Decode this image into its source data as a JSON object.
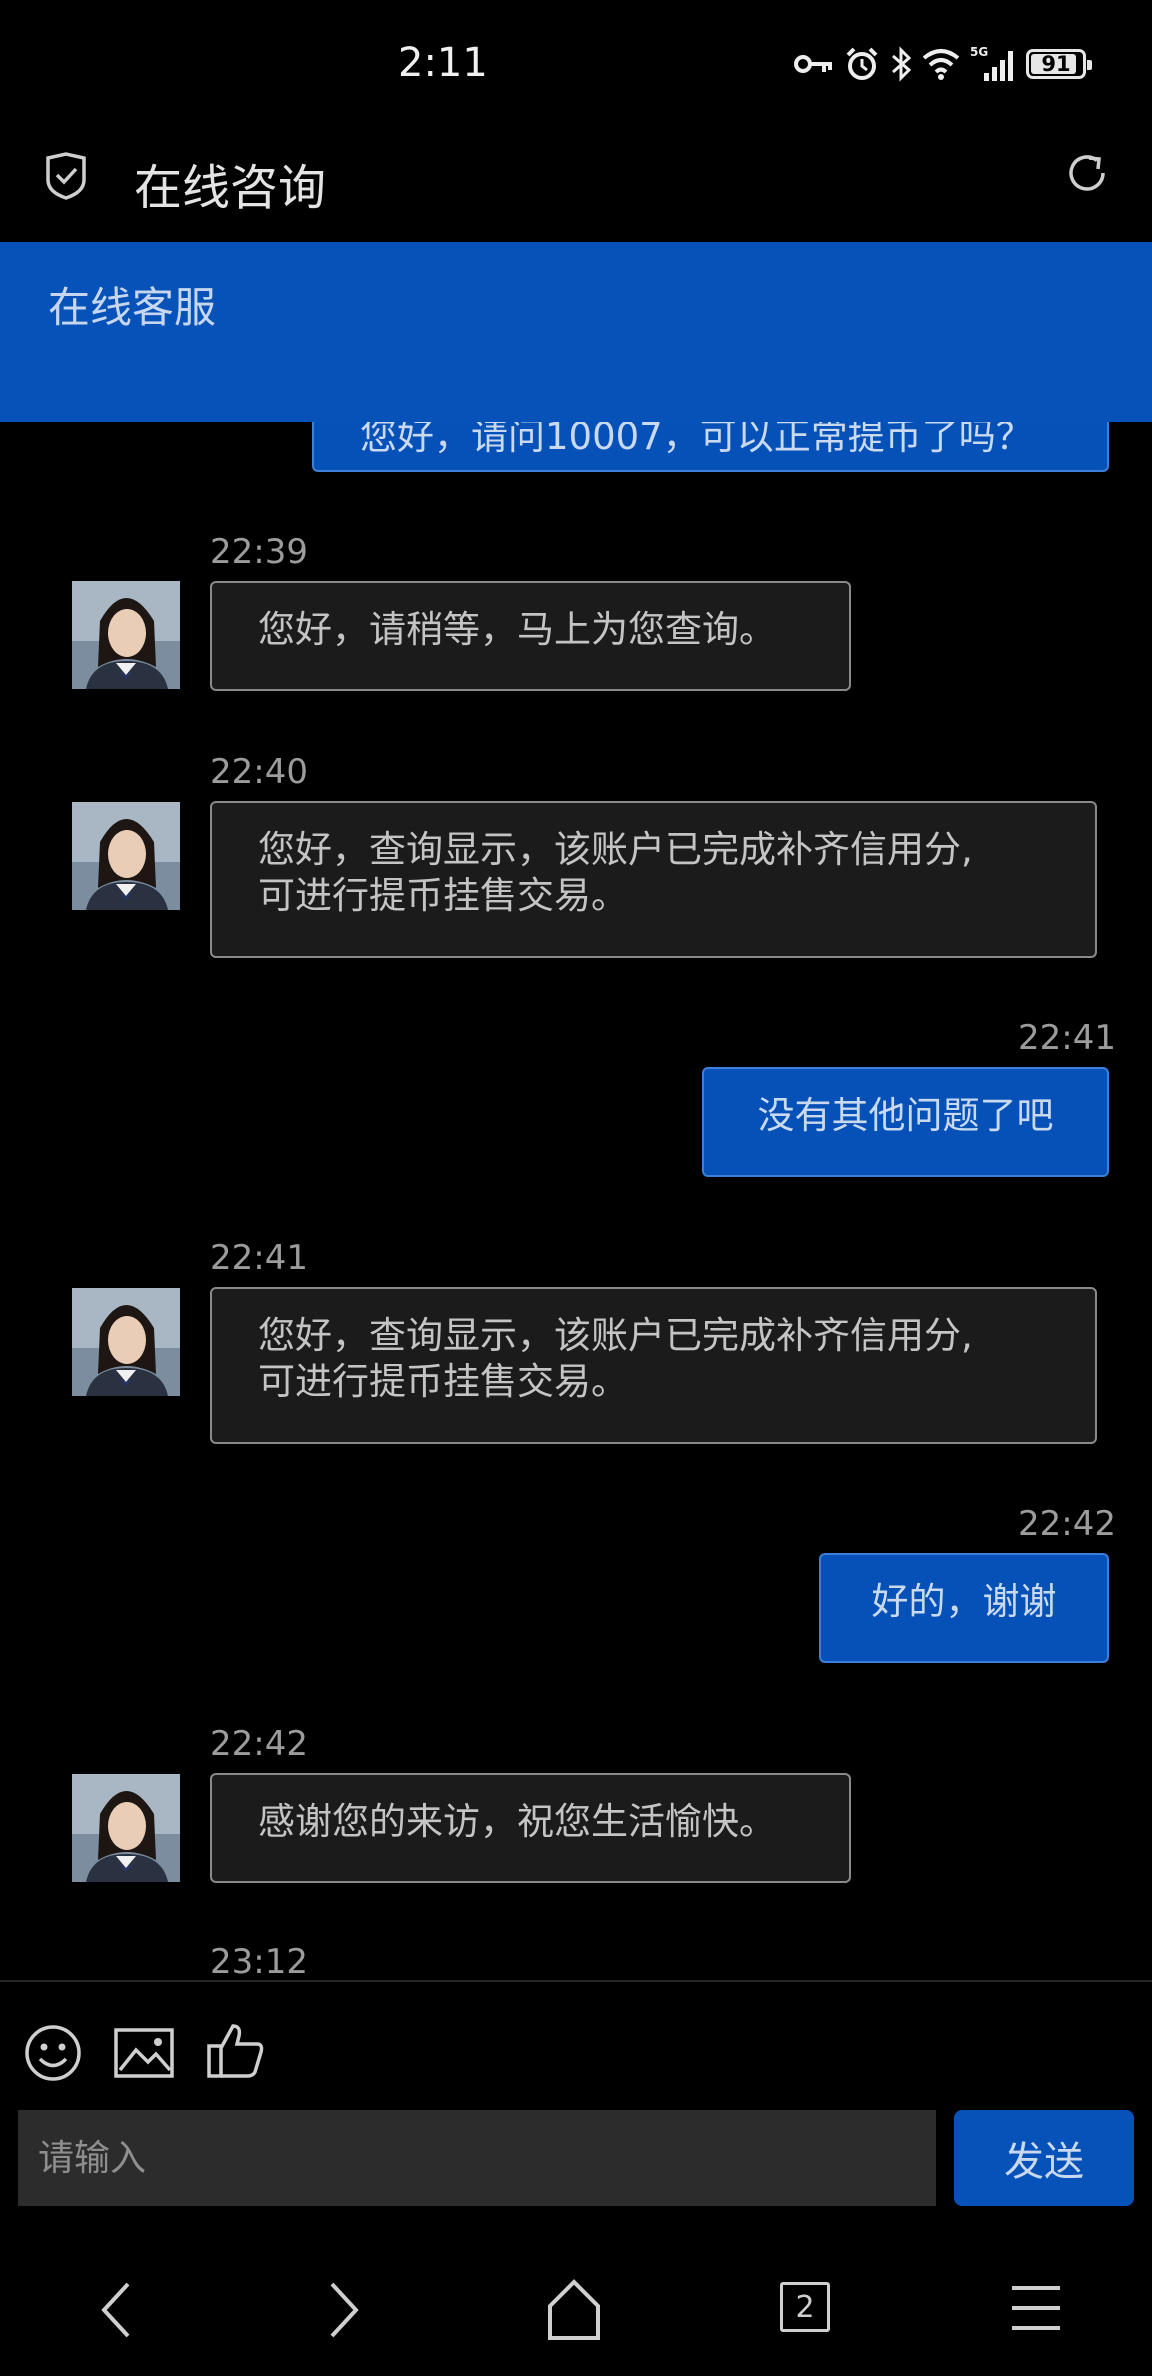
{
  "status_bar": {
    "time": "2:11",
    "battery_level": "91",
    "network": "5G"
  },
  "header": {
    "title": "在线咨询"
  },
  "chat": {
    "service_label": "在线客服",
    "top_partial_message": "您好，请问10007，可以正常提币了吗？",
    "messages": [
      {
        "sender": "agent",
        "time": "22:39",
        "line1": "您好，请稍等，马上为您查询。",
        "line2": ""
      },
      {
        "sender": "agent",
        "time": "22:40",
        "line1": "您好，查询显示，该账户已完成补齐信用分,",
        "line2": "可进行提币挂售交易。"
      },
      {
        "sender": "user",
        "time": "22:41",
        "line1": "没有其他问题了吧",
        "line2": ""
      },
      {
        "sender": "agent",
        "time": "22:41",
        "line1": "您好，查询显示，该账户已完成补齐信用分,",
        "line2": "可进行提币挂售交易。"
      },
      {
        "sender": "user",
        "time": "22:42",
        "line1": "好的，谢谢",
        "line2": ""
      },
      {
        "sender": "agent",
        "time": "22:42",
        "line1": "感谢您的来访，祝您生活愉快。",
        "line2": ""
      },
      {
        "sender": "agent",
        "time": "23:12",
        "line1": "",
        "line2": ""
      }
    ]
  },
  "toolbar": {
    "icons": [
      "emoji-icon",
      "image-icon",
      "thumbs-up-icon"
    ]
  },
  "input": {
    "placeholder": "请输入",
    "value": "",
    "send_label": "发送"
  },
  "nav_bar": {
    "tabs_count": "2"
  },
  "colors": {
    "accent": "#0752b8",
    "background": "#000000",
    "agent_bubble": "#1b1b1b"
  }
}
